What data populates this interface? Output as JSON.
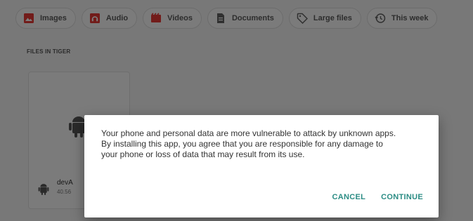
{
  "filter_chips": [
    {
      "label": "Images",
      "icon": "image-icon",
      "color": "#e53935"
    },
    {
      "label": "Audio",
      "icon": "audio-icon",
      "color": "#e53935"
    },
    {
      "label": "Videos",
      "icon": "video-icon",
      "color": "#e53935"
    },
    {
      "label": "Documents",
      "icon": "document-icon",
      "color": "#616161"
    },
    {
      "label": "Large files",
      "icon": "tag-icon",
      "color": "#616161"
    },
    {
      "label": "This week",
      "icon": "history-icon",
      "color": "#616161"
    }
  ],
  "section": {
    "label": "FILES IN TIGER"
  },
  "file": {
    "name": "devA",
    "size": "40.56",
    "icon": "android-icon"
  },
  "dialog": {
    "message": "Your phone and personal data are more vulnerable to attack by unknown apps. By installing this app, you agree that you are responsible for any damage to your phone or loss of data that may result from its use.",
    "cancel_label": "CANCEL",
    "continue_label": "CONTINUE",
    "accent_color": "#2b8c84"
  }
}
